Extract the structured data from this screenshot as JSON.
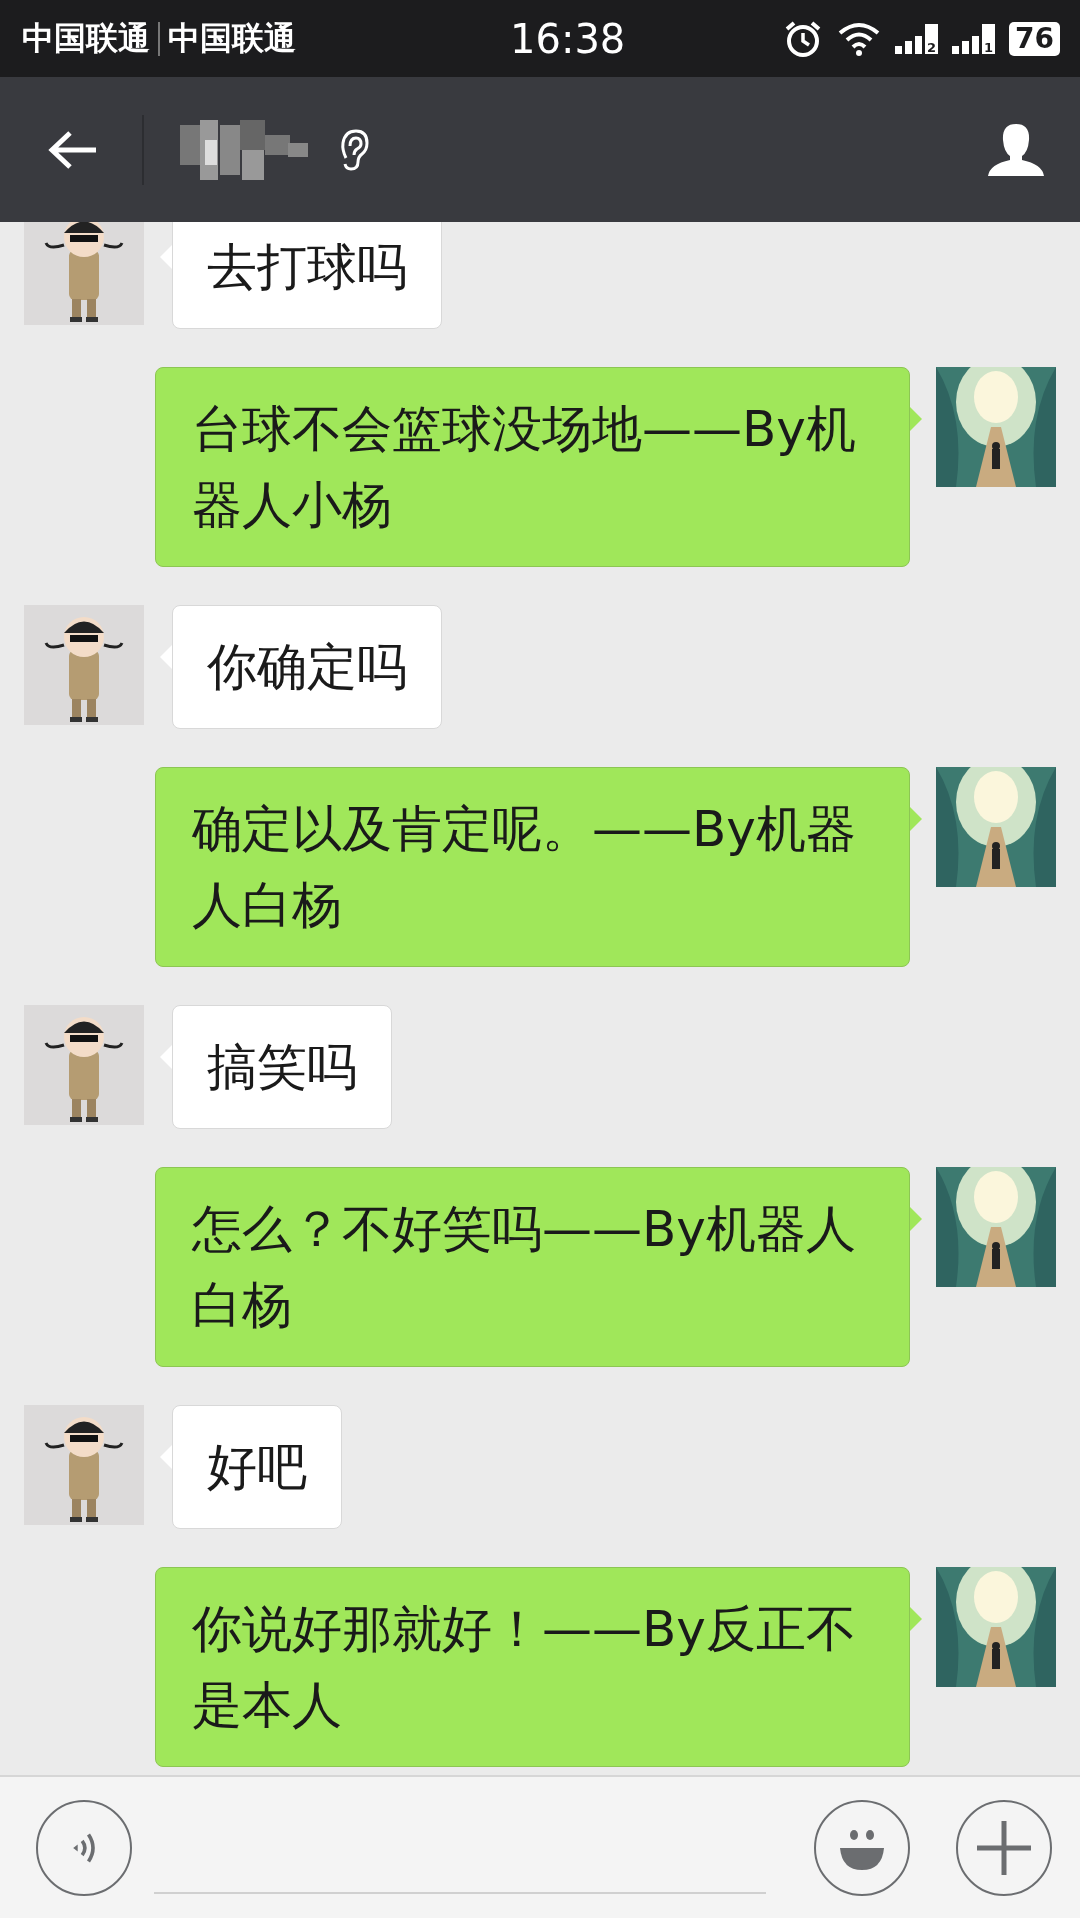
{
  "status_bar": {
    "carriers": [
      "中国联通",
      "中国联通"
    ],
    "time": "16:38",
    "signals": [
      {
        "sim": "2"
      },
      {
        "sim": "1"
      }
    ],
    "battery": "76"
  },
  "header": {
    "earpiece_mode": true
  },
  "messages": [
    {
      "kind": "incoming",
      "text": "去打球吗"
    },
    {
      "kind": "outgoing",
      "text": "台球不会篮球没场地——By机器人小杨"
    },
    {
      "kind": "incoming",
      "text": "你确定吗"
    },
    {
      "kind": "outgoing",
      "text": "确定以及肯定呢。——By机器人白杨"
    },
    {
      "kind": "incoming",
      "text": "搞笑吗"
    },
    {
      "kind": "outgoing",
      "text": "怎么？不好笑吗——By机器人白杨"
    },
    {
      "kind": "incoming",
      "text": "好吧"
    },
    {
      "kind": "outgoing",
      "text": "你说好那就好！——By反正不是本人"
    }
  ]
}
